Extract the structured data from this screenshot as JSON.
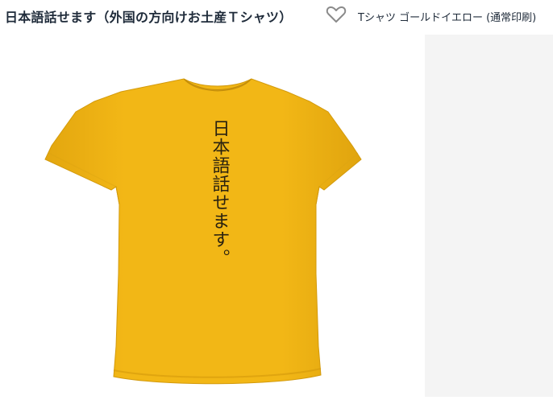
{
  "header": {
    "product_title": "日本語話せます（外国の方向けお土産Ｔシャツ）",
    "favorite_icon": "heart-outline-icon",
    "variant_text": "Tシャツ ゴールドイエロー (通常印刷)"
  },
  "product": {
    "shirt_color": "#F2B716",
    "print_text": "日本語話せます。"
  },
  "colors": {
    "title": "#1f2b3a",
    "panel": "#f4f4f4"
  }
}
